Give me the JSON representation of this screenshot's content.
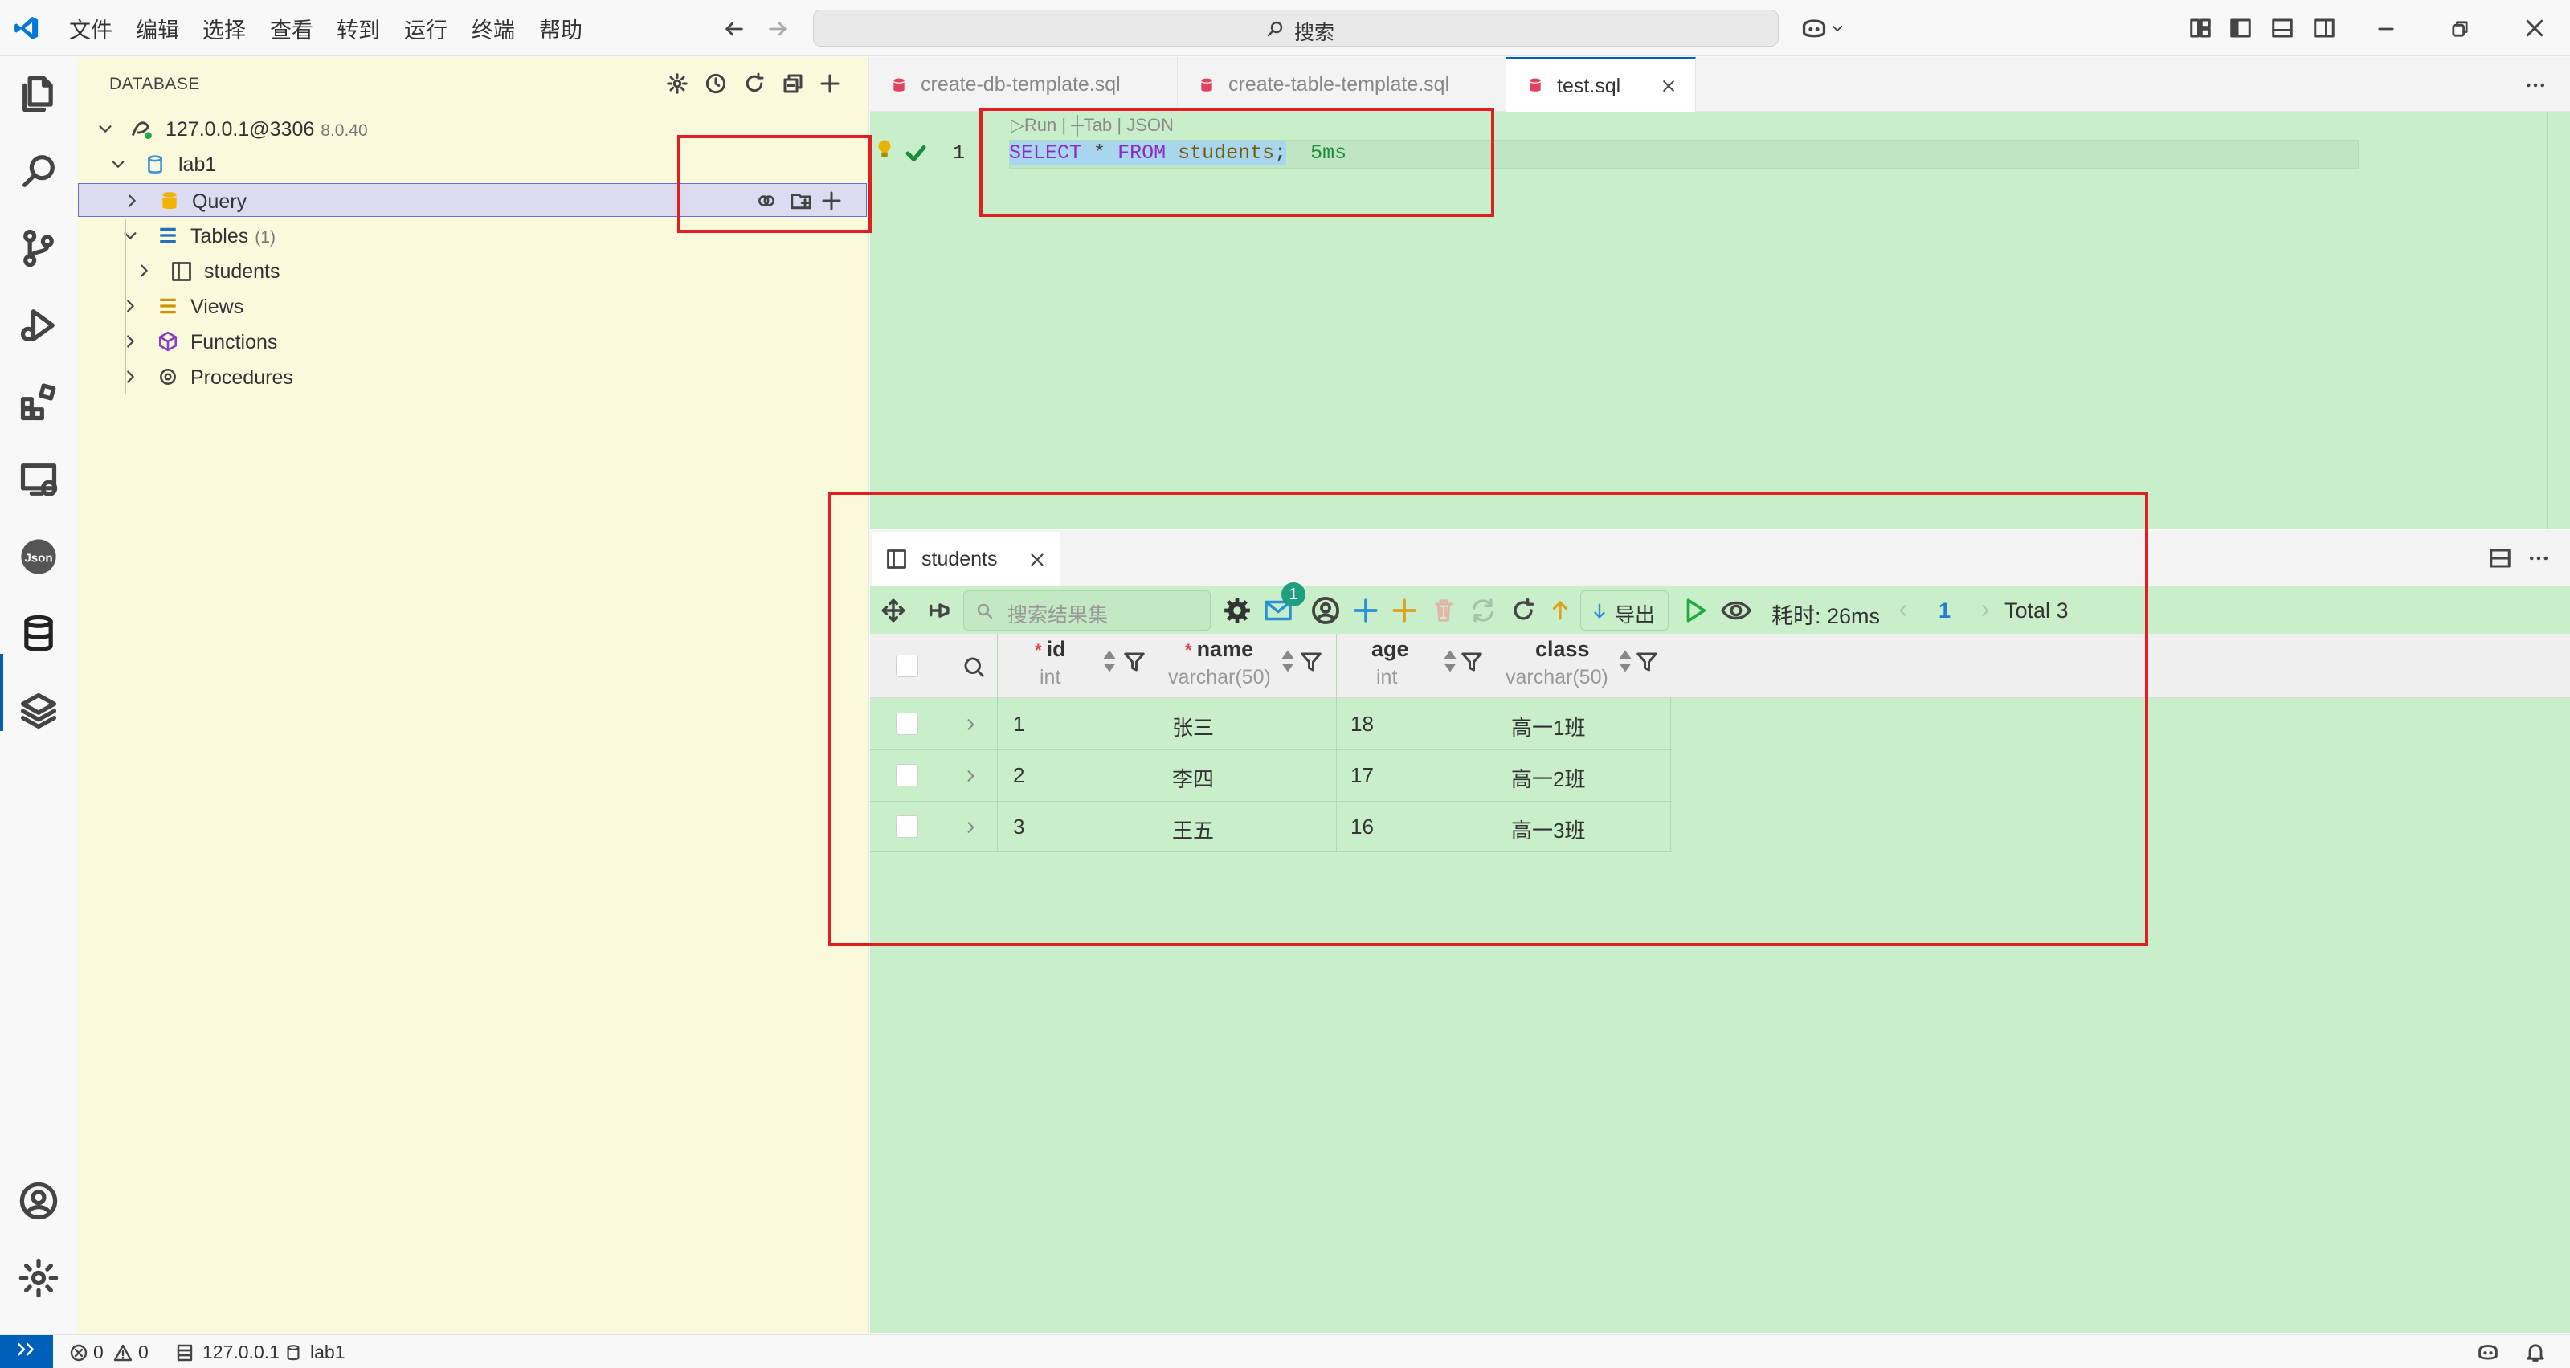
{
  "menu": [
    "文件",
    "编辑",
    "选择",
    "查看",
    "转到",
    "运行",
    "终端",
    "帮助"
  ],
  "search": {
    "placeholder": "搜索"
  },
  "sidebar": {
    "title": "DATABASE",
    "connection": {
      "label": "127.0.0.1@3306",
      "version": "8.0.40"
    },
    "database": "lab1",
    "query": "Query",
    "tables": {
      "label": "Tables",
      "count": "(1)"
    },
    "table_students": "students",
    "views": "Views",
    "functions": "Functions",
    "procedures": "Procedures"
  },
  "tabs": [
    {
      "label": "create-db-template.sql"
    },
    {
      "label": "create-table-template.sql"
    },
    {
      "label": "test.sql"
    }
  ],
  "editor": {
    "codelens": "▷Run | ┼Tab | JSON",
    "line_number": "1",
    "kw_select": "SELECT",
    "star": "*",
    "kw_from": "FROM",
    "table": "students",
    "semicolon": ";",
    "timing": "5ms"
  },
  "result": {
    "tab_label": "students",
    "search_placeholder": "搜索结果集",
    "notification_count": "1",
    "export_label": "导出",
    "elapsed": "耗时: 26ms",
    "page": "1",
    "total": "Total 3",
    "columns": [
      {
        "name": "id",
        "type": "int",
        "required": "*"
      },
      {
        "name": "name",
        "type": "varchar(50)",
        "required": "*"
      },
      {
        "name": "age",
        "type": "int",
        "required": ""
      },
      {
        "name": "class",
        "type": "varchar(50)",
        "required": ""
      }
    ],
    "rows": [
      [
        "1",
        "张三",
        "18",
        "高一1班"
      ],
      [
        "2",
        "李四",
        "17",
        "高一2班"
      ],
      [
        "3",
        "王五",
        "16",
        "高一3班"
      ]
    ]
  },
  "status": {
    "errors": "0",
    "warnings": "0",
    "host": "127.0.0.1",
    "db": "lab1"
  },
  "colors": {
    "accent": "#005fb8",
    "sidebar_bg": "#fbf9dc",
    "editor_bg": "#c8efc9",
    "annotation_red": "#e02020",
    "db_icon_red": "#e0415e"
  }
}
